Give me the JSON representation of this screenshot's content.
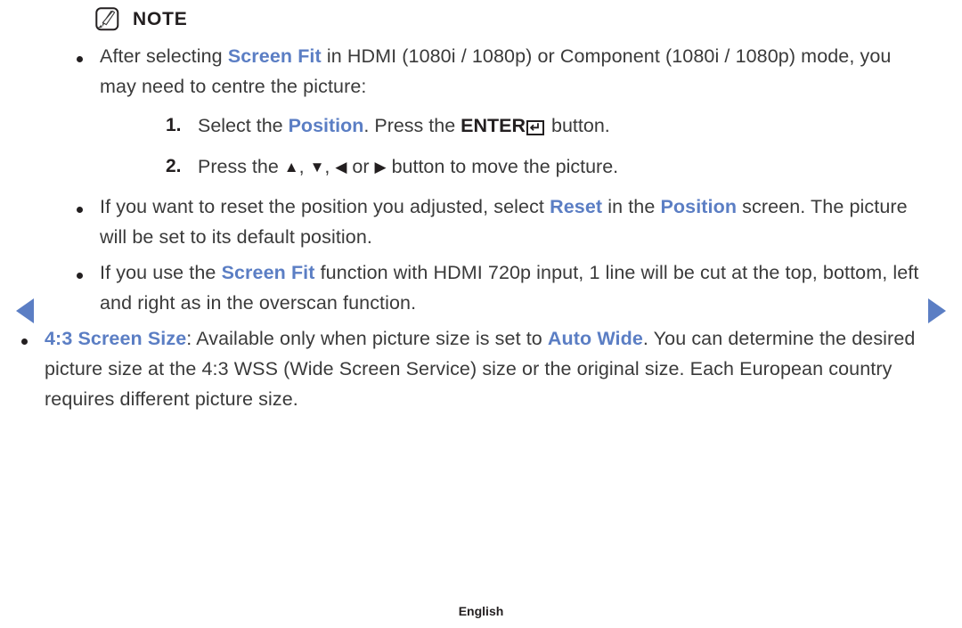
{
  "note": {
    "icon_name": "note-pencil-icon",
    "title": "NOTE"
  },
  "accent_color": "#5b7ec4",
  "text_color": "#3a3a3a",
  "bullets": [
    {
      "id": "screen-fit-centre",
      "segments": [
        {
          "text": "After selecting ",
          "style": "normal"
        },
        {
          "text": "Screen Fit",
          "style": "highlight"
        },
        {
          "text": " in HDMI (1080i / 1080p) or Component (1080i / 1080p) mode, you may need to centre the picture:",
          "style": "normal"
        }
      ]
    },
    {
      "id": "reset-position",
      "segments": [
        {
          "text": "If you want to reset the position you adjusted, select ",
          "style": "normal"
        },
        {
          "text": "Reset",
          "style": "highlight"
        },
        {
          "text": " in the ",
          "style": "normal"
        },
        {
          "text": "Position",
          "style": "highlight"
        },
        {
          "text": " screen. The picture will be set to its default position.",
          "style": "normal"
        }
      ]
    },
    {
      "id": "screen-fit-720p",
      "segments": [
        {
          "text": "If you use the ",
          "style": "normal"
        },
        {
          "text": "Screen Fit",
          "style": "highlight"
        },
        {
          "text": " function with HDMI 720p input, 1 line will be cut at the top, bottom, left and right as in the overscan function.",
          "style": "normal"
        }
      ]
    },
    {
      "id": "4-3-screen-size",
      "segments": [
        {
          "text": "4:3 Screen Size",
          "style": "highlight"
        },
        {
          "text": ": Available only when picture size is set to ",
          "style": "normal"
        },
        {
          "text": "Auto Wide",
          "style": "highlight"
        },
        {
          "text": ". You can determine the desired picture size at the 4:3 WSS (Wide Screen Service) size or the original size. Each European country requires different picture size.",
          "style": "normal"
        }
      ]
    }
  ],
  "steps": [
    {
      "marker": "1.",
      "pre": "Select the ",
      "highlight": "Position",
      "mid": ". Press the ",
      "bold": "ENTER",
      "key_glyph": "↵",
      "key_name": "enter-return-key-icon",
      "post": " button."
    },
    {
      "marker": "2.",
      "pre": "Press the ",
      "arrows": [
        {
          "glyph": "▲",
          "name": "arrow-up-icon"
        },
        {
          "glyph": "▼",
          "name": "arrow-down-icon"
        },
        {
          "glyph": "◀",
          "name": "arrow-left-icon"
        },
        {
          "glyph": "▶",
          "name": "arrow-right-icon"
        }
      ],
      "sep1": ", ",
      "sep2": ", ",
      "sep3": " or ",
      "post": " button to move the picture."
    }
  ],
  "nav": {
    "prev_icon": "previous-page-arrow-icon",
    "next_icon": "next-page-arrow-icon"
  },
  "footer": {
    "language": "English"
  }
}
